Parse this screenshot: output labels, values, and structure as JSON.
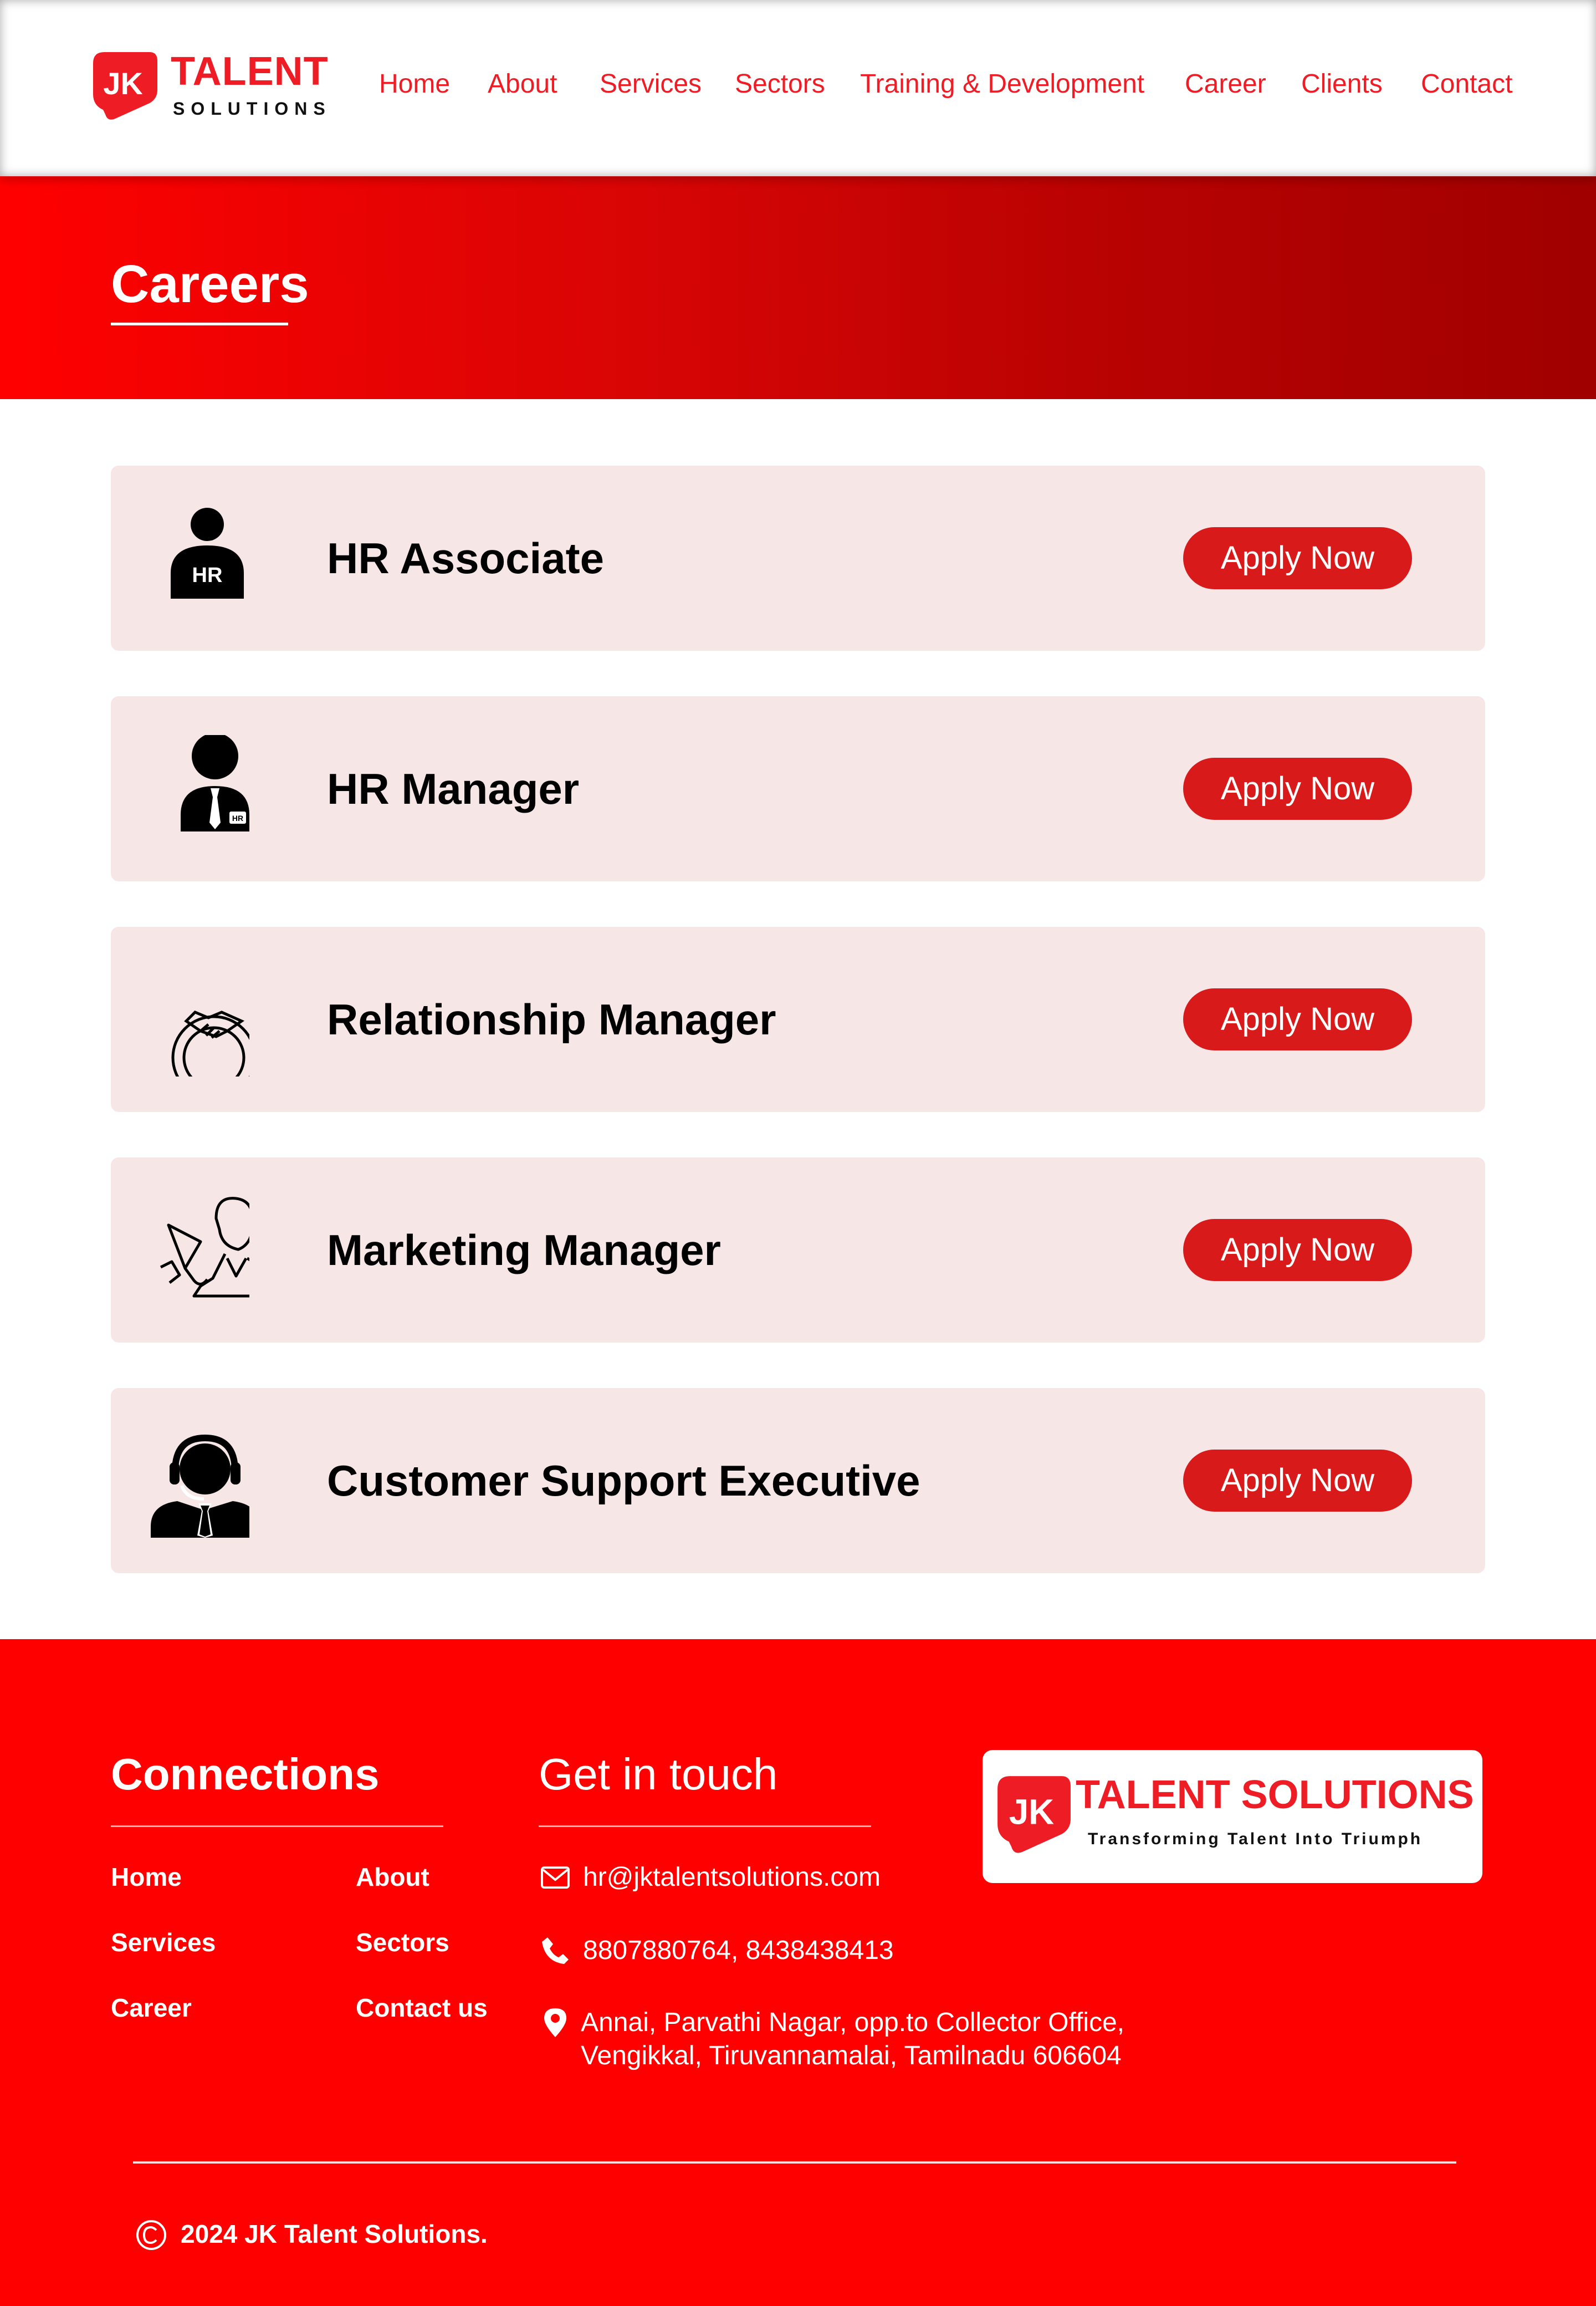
{
  "brand": {
    "logo_main": "TALENT",
    "logo_sub": "SOLUTIONS",
    "logo_initials": "JK",
    "accent_color": "#ee1c25"
  },
  "nav": {
    "items": [
      {
        "label": "Home"
      },
      {
        "label": "About"
      },
      {
        "label": "Services"
      },
      {
        "label": "Sectors"
      },
      {
        "label": "Training & Development"
      },
      {
        "label": "Career"
      },
      {
        "label": "Clients"
      },
      {
        "label": "Contact"
      }
    ]
  },
  "banner": {
    "title": "Careers",
    "gradient": [
      "#ff0000",
      "#a00000"
    ]
  },
  "jobs": [
    {
      "title": "HR Associate",
      "icon": "hr-associate-icon",
      "button": "Apply Now",
      "icon_label": "HR"
    },
    {
      "title": "HR Manager",
      "icon": "hr-manager-icon",
      "button": "Apply Now",
      "icon_label": "HR"
    },
    {
      "title": "Relationship Manager",
      "icon": "handshake-gear-icon",
      "button": "Apply Now"
    },
    {
      "title": "Marketing Manager",
      "icon": "megaphone-person-icon",
      "button": "Apply Now"
    },
    {
      "title": "Customer Support Executive",
      "icon": "headset-agent-icon",
      "button": "Apply Now"
    }
  ],
  "footer": {
    "connections_title": "Connections",
    "links": [
      {
        "label": "Home"
      },
      {
        "label": "About"
      },
      {
        "label": "Services"
      },
      {
        "label": "Sectors"
      },
      {
        "label": "Career"
      },
      {
        "label": "Contact us"
      }
    ],
    "get_in_touch_title": "Get in touch",
    "email": "hr@jktalentsolutions.com",
    "phone": "8807880764, 8438438413",
    "address_line1": "Annai, Parvathi Nagar, opp.to Collector Office,",
    "address_line2": "Vengikkal, Tiruvannamalai, Tamilnadu 606604",
    "badge_main": "TALENT SOLUTIONS",
    "badge_tagline": "Transforming Talent Into Triumph",
    "badge_initials": "JK",
    "copyright": "2024 JK Talent Solutions.",
    "background_color": "#ff0000"
  }
}
